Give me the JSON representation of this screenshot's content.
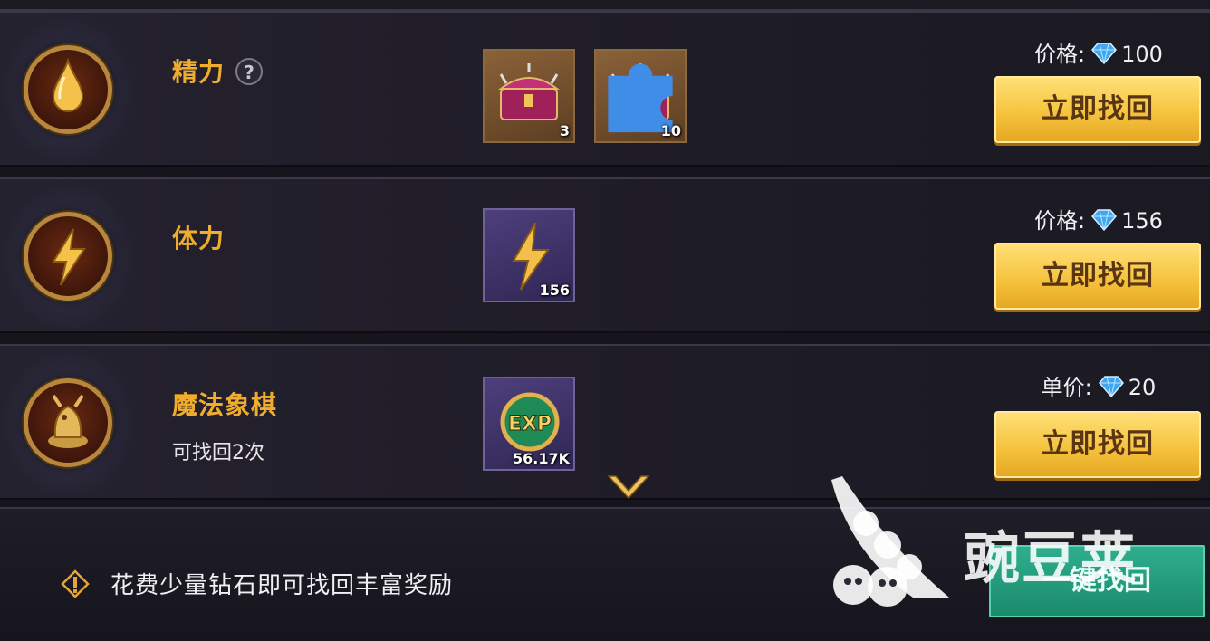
{
  "rows": [
    {
      "title": "精力",
      "help": "?",
      "items": [
        {
          "qty": "3"
        },
        {
          "qty": "10"
        }
      ],
      "price_label": "价格:",
      "price_value": "100",
      "button": "立即找回"
    },
    {
      "title": "体力",
      "items": [
        {
          "qty": "156"
        }
      ],
      "price_label": "价格:",
      "price_value": "156",
      "button": "立即找回"
    },
    {
      "title": "魔法象棋",
      "subtitle": "可找回2次",
      "items": [
        {
          "qty": "56.17K"
        }
      ],
      "price_label": "单价:",
      "price_value": "20",
      "button": "立即找回"
    }
  ],
  "footer": {
    "tip": "花费少量钻石即可找回丰富奖励",
    "one_key_button": "一键找回"
  },
  "watermark": {
    "text": "豌豆荚"
  },
  "colors": {
    "title": "#f0ad2c",
    "button_gold": "#f6c33e",
    "button_green": "#1b8a6c",
    "gem_blue": "#3fa7f0"
  }
}
